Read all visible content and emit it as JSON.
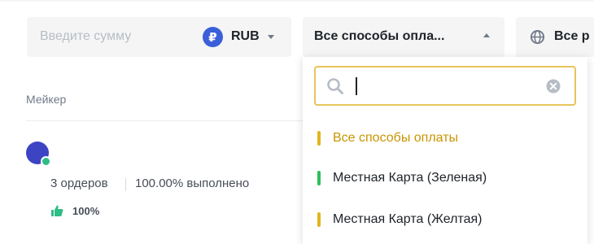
{
  "filters": {
    "amount_placeholder": "Введите сумму",
    "currency": {
      "symbol": "₽",
      "code": "RUB",
      "icon": "ruble-coin-icon",
      "icon_color": "#3b5fd9"
    },
    "payment_method": {
      "selected_label": "Все способы опла...",
      "expanded": true
    },
    "region": {
      "icon": "globe-icon",
      "label": "Все р"
    }
  },
  "dropdown": {
    "search_value": "",
    "options": [
      {
        "label": "Все способы оплаты",
        "bar_color": "#e0b520",
        "selected": true
      },
      {
        "label": "Местная Карта (Зеленая)",
        "bar_color": "#2ebd5a",
        "selected": false
      },
      {
        "label": "Местная Карта (Желтая)",
        "bar_color": "#e0b520",
        "selected": false
      }
    ]
  },
  "table": {
    "maker_header": "Мейкер",
    "rows": [
      {
        "avatar_color": "#3c44c4",
        "online": true,
        "orders": "3 ордеров",
        "completion": "100.00% выполнено",
        "rating": "100%"
      }
    ]
  },
  "colors": {
    "accent": "#c99400",
    "focus_border": "#e8c45a",
    "online": "#2ebd85",
    "muted_text": "#707a8a"
  }
}
